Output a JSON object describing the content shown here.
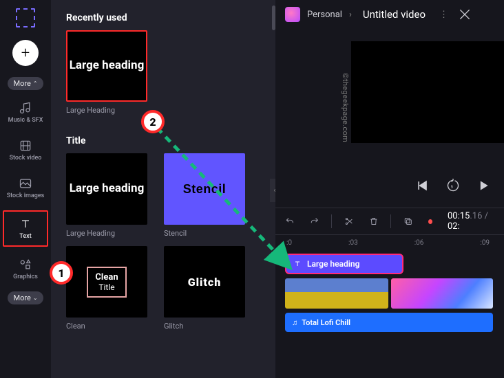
{
  "sidebar": {
    "more1": "More",
    "more2": "More",
    "items": [
      {
        "label": "Music & SFX"
      },
      {
        "label": "Stock video"
      },
      {
        "label": "Stock images"
      },
      {
        "label": "Text"
      },
      {
        "label": "Graphics"
      }
    ]
  },
  "panel": {
    "recent_header": "Recently used",
    "title_header": "Title",
    "cards": {
      "large_heading_preview": "Large heading",
      "large_heading_label": "Large Heading",
      "stencil_preview": "Stencil",
      "stencil_label": "Stencil",
      "clean_l1": "Clean",
      "clean_l2": "Title",
      "clean_label": "Clean",
      "glitch_preview": "Glitch",
      "glitch_label": "Glitch"
    }
  },
  "header": {
    "workspace": "Personal",
    "title": "Untitled video"
  },
  "watermark": "©thegeekpage.com",
  "timecode": {
    "current": "00:15",
    "frames": ".16",
    "sep": " / ",
    "total": "02:"
  },
  "ruler": [
    ":0",
    ":03",
    ":06",
    ":09"
  ],
  "timeline": {
    "text_clip": "Large heading",
    "audio_clip": "Total Lofi Chill"
  },
  "annotation": {
    "step1": "1",
    "step2": "2"
  }
}
